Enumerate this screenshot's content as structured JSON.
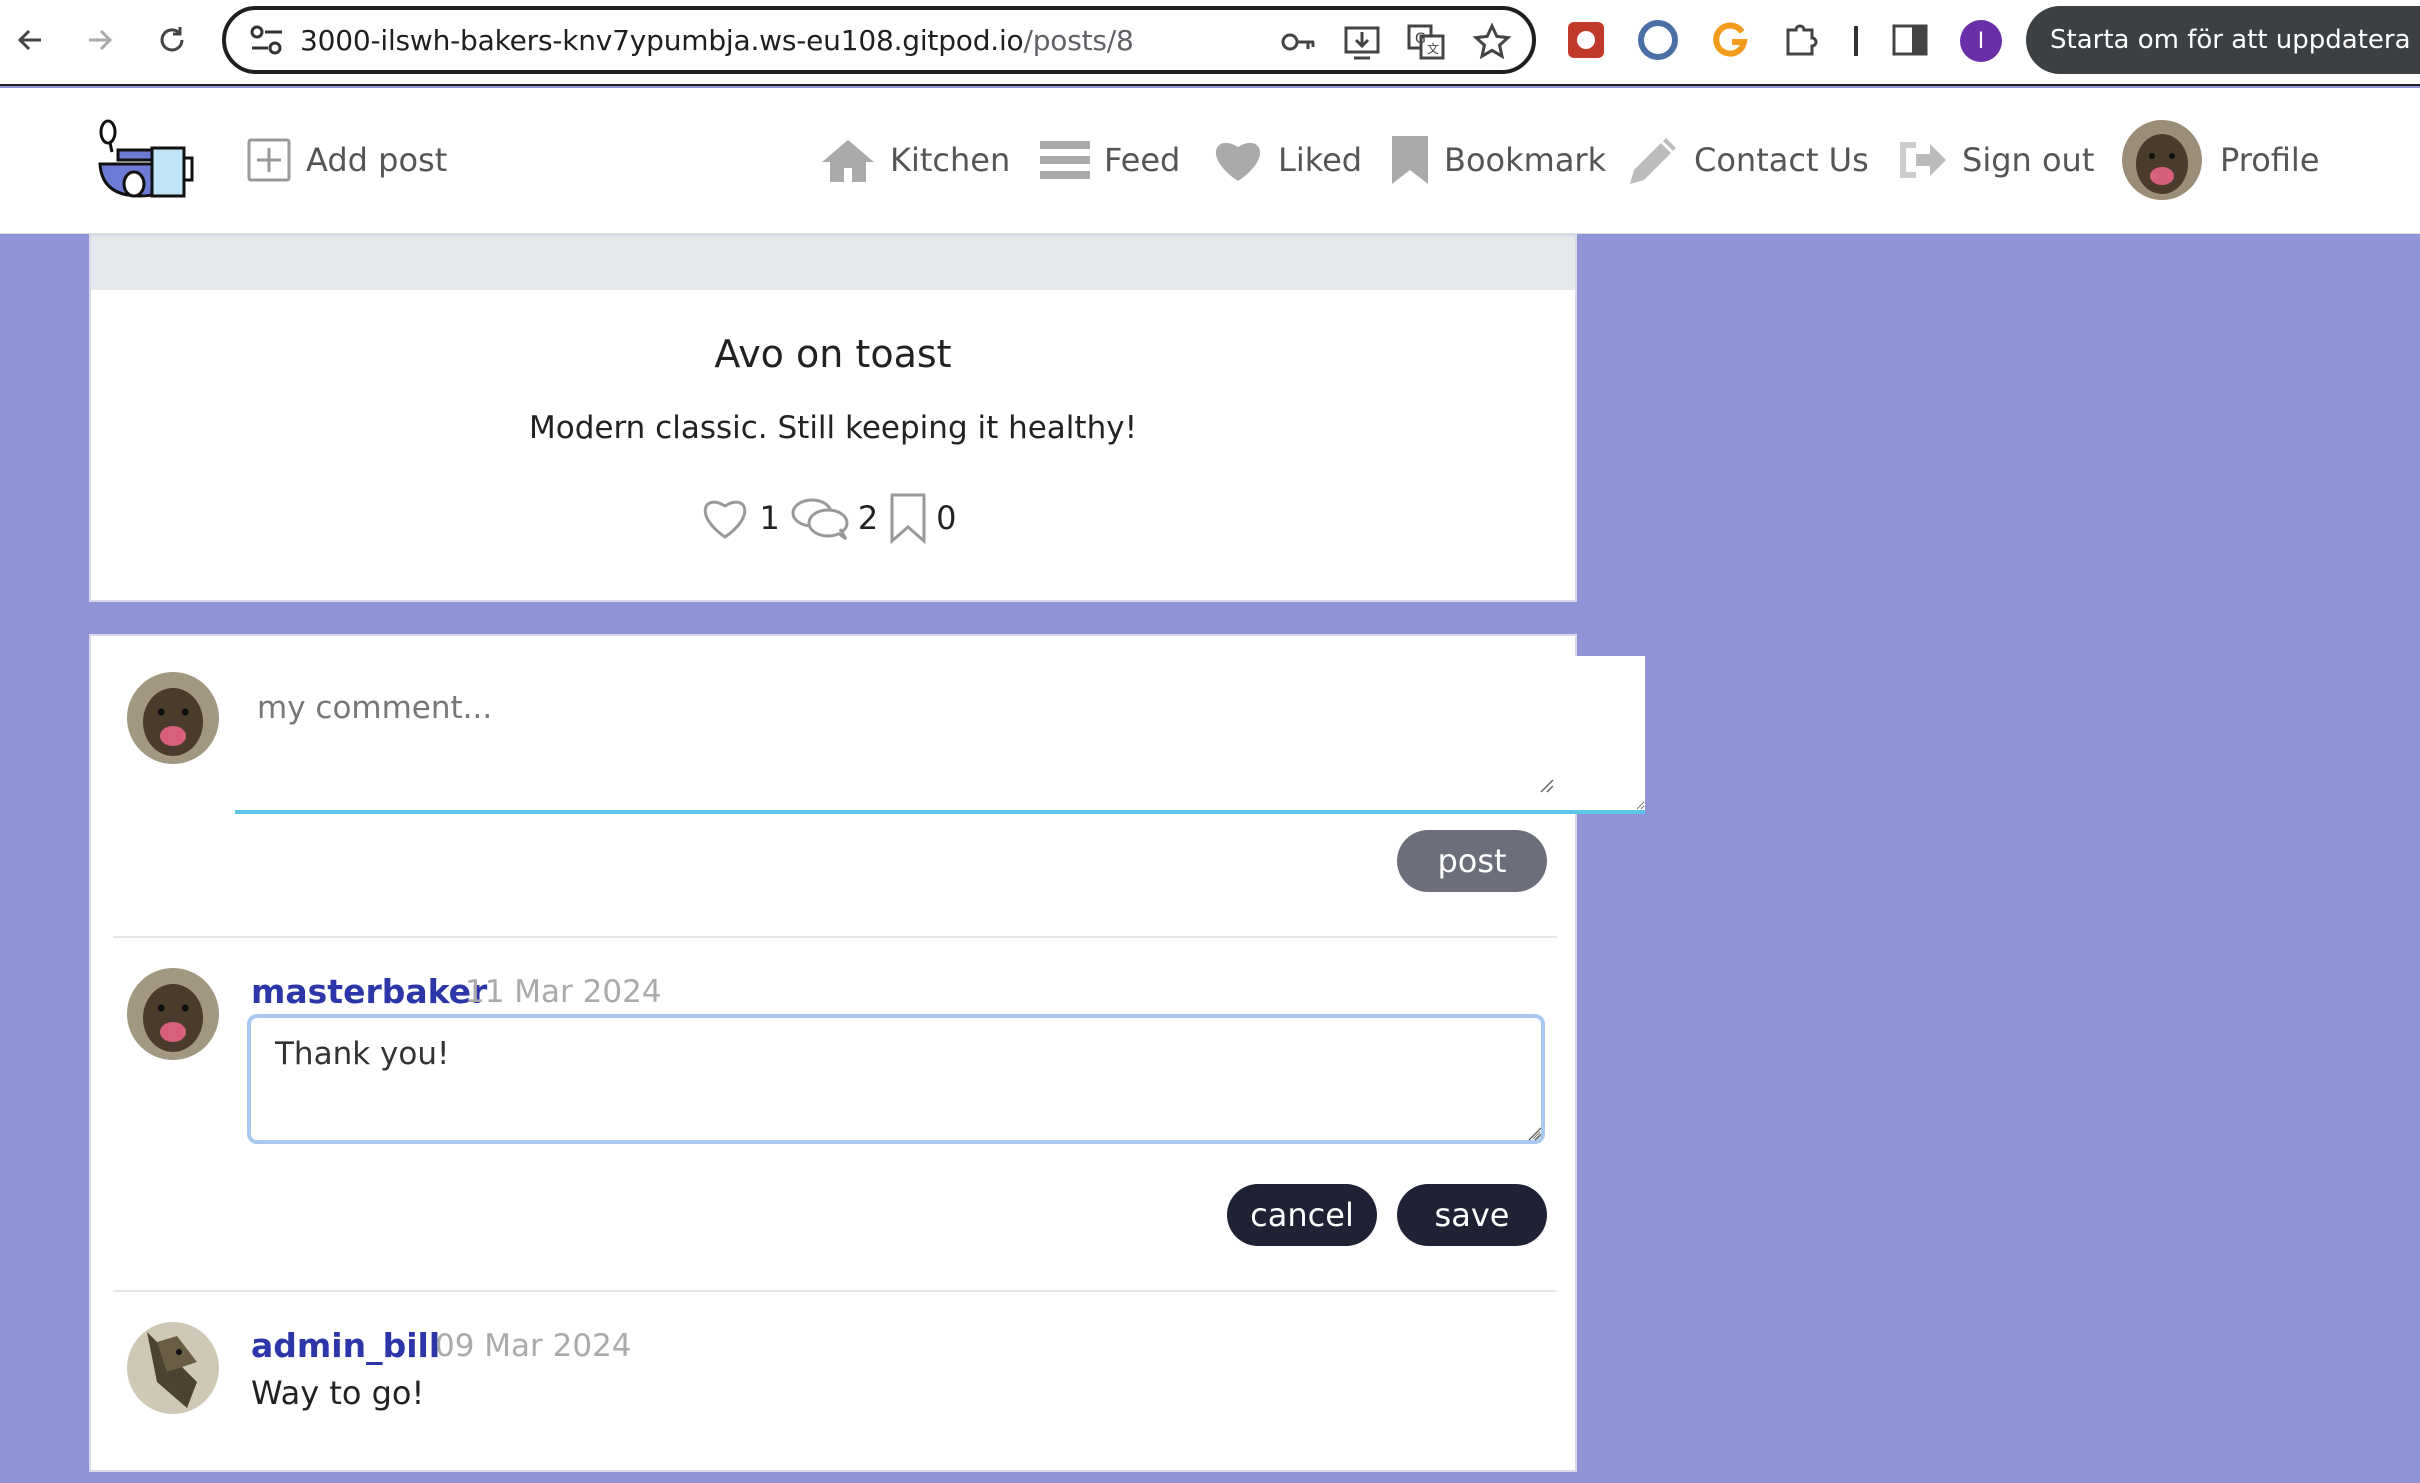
{
  "browser": {
    "url_host": "3000-ilswh-bakers-knv7ypumbja.ws-eu108.gitpod.io",
    "url_path": "/posts/8",
    "update_label": "Starta om för att uppdatera",
    "profile_initial": "I",
    "colors": {
      "profile_badge": "#6a2fa8",
      "ext_orange": "#f29b1d",
      "ext_red": "#c0392b",
      "ext_blue": "#4a6fa5"
    }
  },
  "header": {
    "add_post": "Add post",
    "nav": {
      "kitchen": "Kitchen",
      "feed": "Feed",
      "liked": "Liked",
      "bookmark": "Bookmark",
      "contact": "Contact Us",
      "signout": "Sign out",
      "profile": "Profile"
    }
  },
  "post": {
    "title": "Avo on toast",
    "description": "Modern classic. Still keeping it healthy!",
    "likes": "1",
    "comments": "2",
    "bookmarks": "0"
  },
  "comment_form": {
    "placeholder": "my comment...",
    "post_label": "post"
  },
  "comments": [
    {
      "author": "masterbaker",
      "date": "11 Mar 2024",
      "edit_value": "Thank you!",
      "cancel_label": "cancel",
      "save_label": "save"
    },
    {
      "author": "admin_bill",
      "date": "09 Mar 2024",
      "text": "Way to go!"
    }
  ],
  "colors": {
    "page_bg": "#8e94d6",
    "author": "#2c36a8",
    "dark_button": "#1f2235",
    "post_button": "#6c6e7c",
    "input_underline": "#5ec6ea"
  }
}
